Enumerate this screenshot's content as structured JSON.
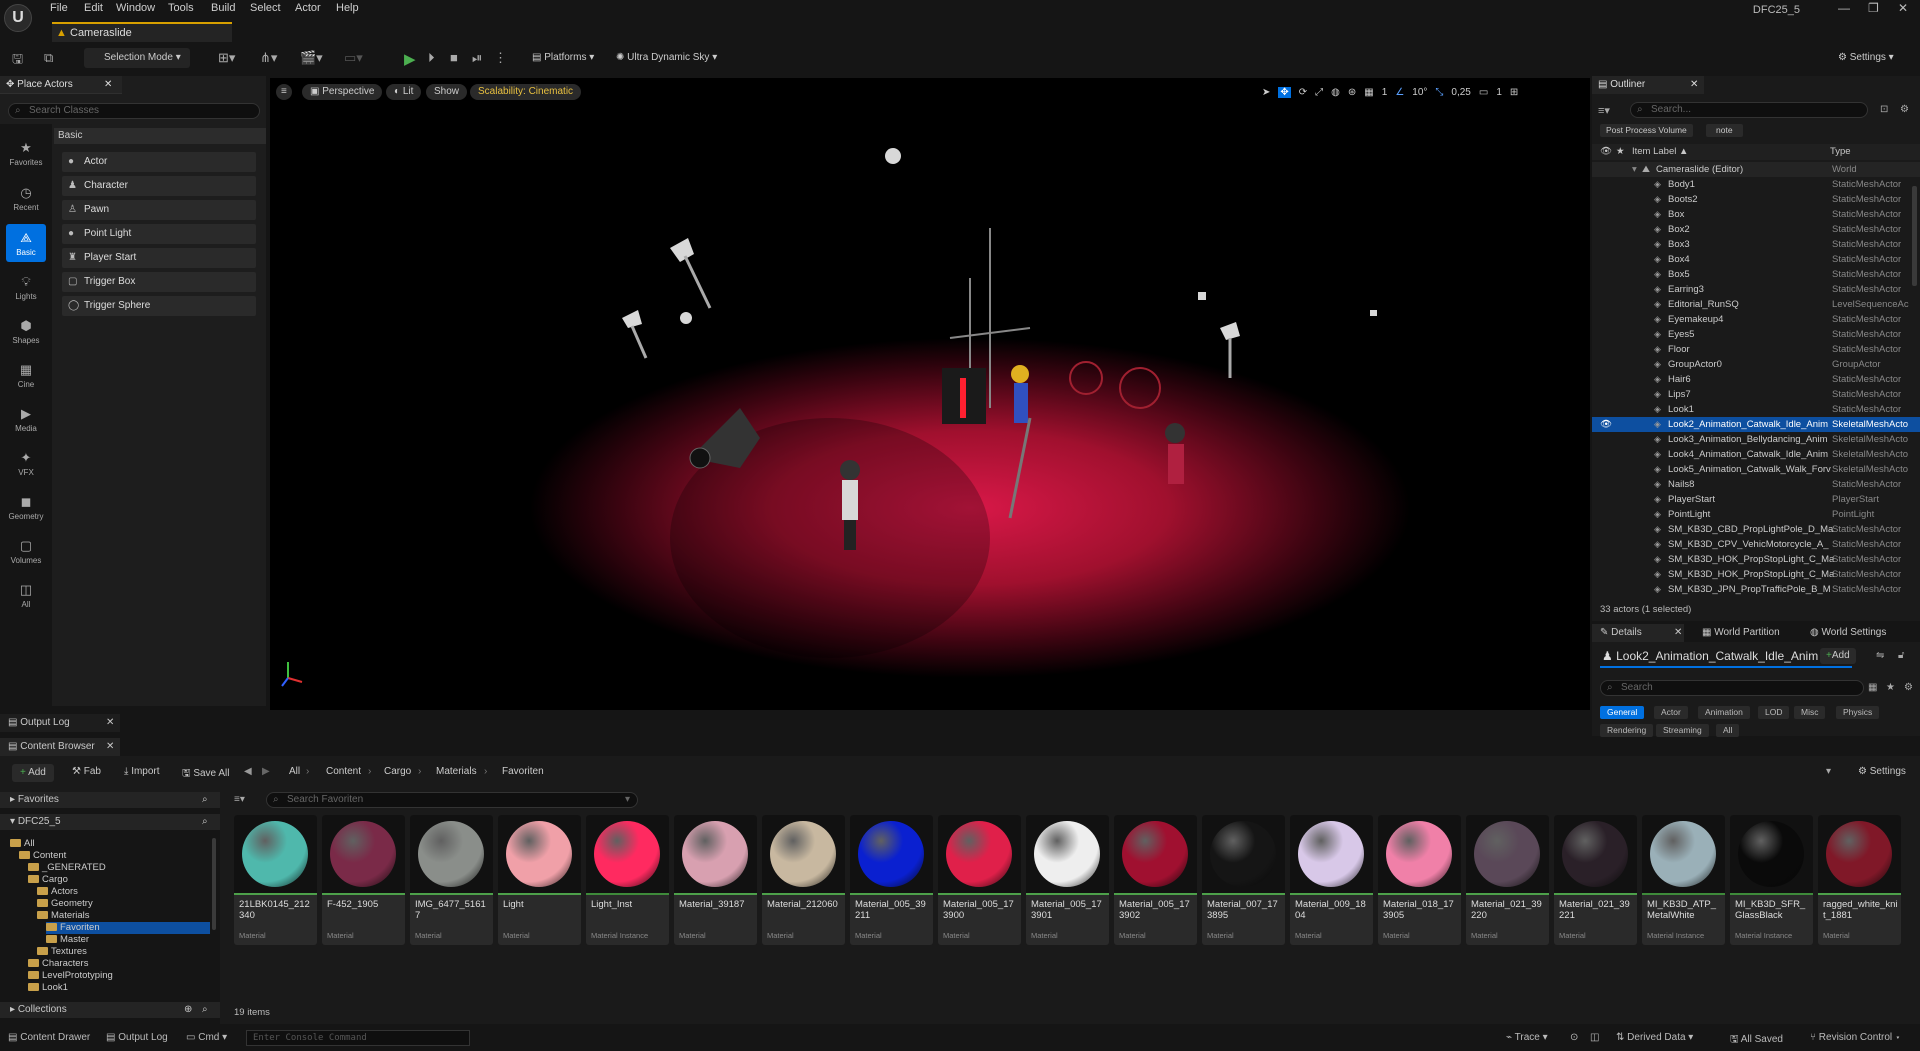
{
  "menu": {
    "items": [
      "File",
      "Edit",
      "Window",
      "Tools",
      "Build",
      "Select",
      "Actor",
      "Help"
    ],
    "project": "DFC25_5"
  },
  "level_tab": "Cameraslide",
  "toolbar": {
    "selection_mode": "Selection Mode",
    "platforms": "Platforms",
    "sky": "Ultra Dynamic Sky",
    "settings": "Settings"
  },
  "place_actors": {
    "tab": "Place Actors",
    "search_placeholder": "Search Classes",
    "section": "Basic",
    "categories": [
      "Favorites",
      "Recent",
      "Basic",
      "Lights",
      "Shapes",
      "Cine",
      "Media",
      "VFX",
      "Geometry",
      "Volumes",
      "All"
    ],
    "items": [
      "Actor",
      "Character",
      "Pawn",
      "Point Light",
      "Player Start",
      "Trigger Box",
      "Trigger Sphere"
    ]
  },
  "viewport": {
    "perspective": "Perspective",
    "lit": "Lit",
    "show": "Show",
    "scalability": "Scalability: Cinematic",
    "grid": "1",
    "angle": "10°",
    "scale": "0,25",
    "cam": "1"
  },
  "outliner": {
    "tab": "Outliner",
    "search_placeholder": "Search...",
    "filters": [
      "Post Process Volume",
      "note"
    ],
    "col_label": "Item Label",
    "col_type": "Type",
    "world": {
      "label": "Cameraslide (Editor)",
      "type": "World"
    },
    "rows": [
      {
        "label": "Body1",
        "type": "StaticMeshActor"
      },
      {
        "label": "Boots2",
        "type": "StaticMeshActor"
      },
      {
        "label": "Box",
        "type": "StaticMeshActor"
      },
      {
        "label": "Box2",
        "type": "StaticMeshActor"
      },
      {
        "label": "Box3",
        "type": "StaticMeshActor"
      },
      {
        "label": "Box4",
        "type": "StaticMeshActor"
      },
      {
        "label": "Box5",
        "type": "StaticMeshActor"
      },
      {
        "label": "Earring3",
        "type": "StaticMeshActor"
      },
      {
        "label": "Editorial_RunSQ",
        "type": "LevelSequenceAc"
      },
      {
        "label": "Eyemakeup4",
        "type": "StaticMeshActor"
      },
      {
        "label": "Eyes5",
        "type": "StaticMeshActor"
      },
      {
        "label": "Floor",
        "type": "StaticMeshActor"
      },
      {
        "label": "GroupActor0",
        "type": "GroupActor"
      },
      {
        "label": "Hair6",
        "type": "StaticMeshActor"
      },
      {
        "label": "Lips7",
        "type": "StaticMeshActor"
      },
      {
        "label": "Look1",
        "type": "StaticMeshActor"
      },
      {
        "label": "Look2_Animation_Catwalk_Idle_Anim",
        "type": "SkeletalMeshActo"
      },
      {
        "label": "Look3_Animation_Bellydancing_Anim",
        "type": "SkeletalMeshActo"
      },
      {
        "label": "Look4_Animation_Catwalk_Idle_Anim",
        "type": "SkeletalMeshActo"
      },
      {
        "label": "Look5_Animation_Catwalk_Walk_Forv",
        "type": "SkeletalMeshActo"
      },
      {
        "label": "Nails8",
        "type": "StaticMeshActor"
      },
      {
        "label": "PlayerStart",
        "type": "PlayerStart"
      },
      {
        "label": "PointLight",
        "type": "PointLight"
      },
      {
        "label": "SM_KB3D_CBD_PropLightPole_D_Ma",
        "type": "StaticMeshActor"
      },
      {
        "label": "SM_KB3D_CPV_VehicMotorcycle_A_",
        "type": "StaticMeshActor"
      },
      {
        "label": "SM_KB3D_HOK_PropStopLight_C_Ma",
        "type": "StaticMeshActor"
      },
      {
        "label": "SM_KB3D_HOK_PropStopLight_C_Ma",
        "type": "StaticMeshActor"
      },
      {
        "label": "SM_KB3D_JPN_PropTrafficPole_B_M",
        "type": "StaticMeshActor"
      }
    ],
    "count": "33 actors (1 selected)"
  },
  "details": {
    "tabs": [
      "Details",
      "World Partition",
      "World Settings"
    ],
    "actor_name": "Look2_Animation_Catwalk_Idle_Anim",
    "add": "Add",
    "search_placeholder": "Search",
    "filters": [
      "General",
      "Actor",
      "Animation",
      "LOD",
      "Misc",
      "Physics",
      "Rendering",
      "Streaming",
      "All"
    ]
  },
  "bottom_tabs": {
    "output_log": "Output Log",
    "content_browser": "Content Browser"
  },
  "content_browser": {
    "add": "Add",
    "fab": "Fab",
    "import": "Import",
    "save_all": "Save All",
    "path": [
      "All",
      "Content",
      "Cargo",
      "Materials",
      "Favoriten"
    ],
    "settings": "Settings",
    "favorites": "Favorites",
    "project": "DFC25_5",
    "search_placeholder": "Search Favoriten",
    "tree": [
      {
        "label": "All",
        "indent": 0
      },
      {
        "label": "Content",
        "indent": 1
      },
      {
        "label": "_GENERATED",
        "indent": 2
      },
      {
        "label": "Cargo",
        "indent": 2
      },
      {
        "label": "Actors",
        "indent": 3
      },
      {
        "label": "Geometry",
        "indent": 3
      },
      {
        "label": "Materials",
        "indent": 3
      },
      {
        "label": "Favoriten",
        "indent": 4
      },
      {
        "label": "Master",
        "indent": 4
      },
      {
        "label": "Textures",
        "indent": 3
      },
      {
        "label": "Characters",
        "indent": 2
      },
      {
        "label": "LevelPrototyping",
        "indent": 2
      },
      {
        "label": "Look1",
        "indent": 2
      }
    ],
    "collections": "Collections",
    "item_count": "19 items",
    "assets": [
      {
        "name": "21LBK0145_212340",
        "kind": "Material",
        "color": "#4fb8ac"
      },
      {
        "name": "F-452_1905",
        "kind": "Material",
        "color": "#7a2a48"
      },
      {
        "name": "IMG_6477_51617",
        "kind": "Material",
        "color": "#8a8e8a"
      },
      {
        "name": "Light",
        "kind": "Material",
        "color": "#f0a0a8"
      },
      {
        "name": "Light_Inst",
        "kind": "Material Instance",
        "color": "#ff2a60"
      },
      {
        "name": "Material_39187",
        "kind": "Material",
        "color": "#d8a0b0"
      },
      {
        "name": "Material_212060",
        "kind": "Material",
        "color": "#c8b8a0"
      },
      {
        "name": "Material_005_39211",
        "kind": "Material",
        "color": "#0a20d0"
      },
      {
        "name": "Material_005_173900",
        "kind": "Material",
        "color": "#e0204a"
      },
      {
        "name": "Material_005_173901",
        "kind": "Material",
        "color": "#eeeeee"
      },
      {
        "name": "Material_005_173902",
        "kind": "Material",
        "color": "#a01030"
      },
      {
        "name": "Material_007_173895",
        "kind": "Material",
        "color": "#151515"
      },
      {
        "name": "Material_009_1804",
        "kind": "Material",
        "color": "#d8c8e8"
      },
      {
        "name": "Material_018_173905",
        "kind": "Material",
        "color": "#f080a8"
      },
      {
        "name": "Material_021_39220",
        "kind": "Material",
        "color": "#5a4858"
      },
      {
        "name": "Material_021_39221",
        "kind": "Material",
        "color": "#2a2028"
      },
      {
        "name": "MI_KB3D_ATP_MetalWhite",
        "kind": "Material Instance",
        "color": "#9ab0b8"
      },
      {
        "name": "MI_KB3D_SFR_GlassBlack",
        "kind": "Material Instance",
        "color": "#0a0a0a"
      },
      {
        "name": "ragged_white_knit_1881",
        "kind": "Material",
        "color": "#801828"
      }
    ]
  },
  "statusbar": {
    "content_drawer": "Content Drawer",
    "output_log": "Output Log",
    "cmd": "Cmd",
    "console_placeholder": "Enter Console Command",
    "trace": "Trace",
    "derived": "Derived Data",
    "saved": "All Saved",
    "revision": "Revision Control"
  },
  "colors": {
    "accent": "#0070e0",
    "selection": "#0d4fa0",
    "level_tab": "#d8a000",
    "scalability": "#e8c040",
    "play": "#4caf50"
  }
}
